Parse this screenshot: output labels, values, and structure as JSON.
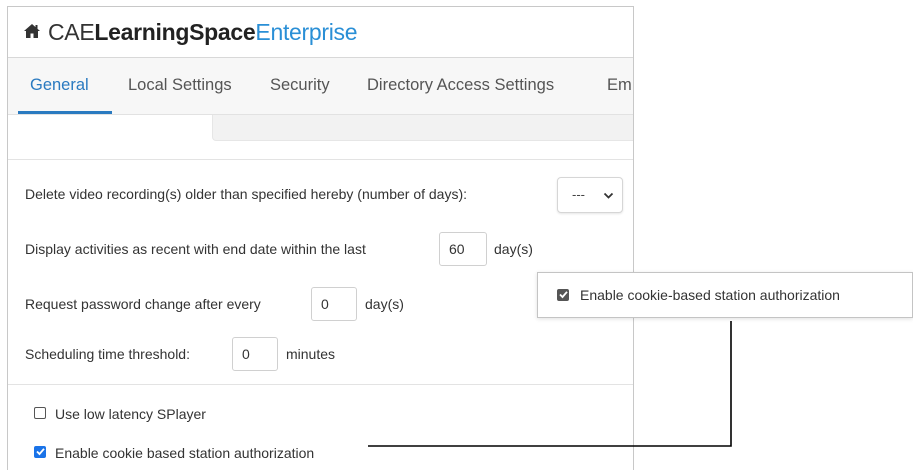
{
  "app": {
    "brand_part1": "CAE",
    "brand_part2": "LearningSpace",
    "brand_part3": "Enterprise",
    "home_icon": "home-icon"
  },
  "tabs": [
    {
      "label": "General",
      "active": true
    },
    {
      "label": "Local Settings",
      "active": false
    },
    {
      "label": "Security",
      "active": false
    },
    {
      "label": "Directory Access Settings",
      "active": false
    },
    {
      "label": "Em",
      "active": false
    }
  ],
  "settings": {
    "delete_video": {
      "label": "Delete video recording(s) older than specified hereby (number of days):",
      "value": "---"
    },
    "recent_activities": {
      "label_before": "Display activities as recent with end date within the last",
      "value": "60",
      "label_after": "day(s)"
    },
    "password_change": {
      "label_before": "Request password change after every",
      "value": "0",
      "label_after": "day(s)"
    },
    "scheduling_threshold": {
      "label_before": "Scheduling time threshold:",
      "value": "0",
      "label_after": "minutes"
    },
    "low_latency": {
      "label": "Use low latency SPlayer",
      "checked": false
    },
    "cookie_auth": {
      "label": "Enable cookie based station authorization",
      "checked": true
    }
  },
  "callout": {
    "label": "Enable cookie-based station authorization",
    "checked": true
  },
  "colors": {
    "accent": "#2a7ac0",
    "brand_blue": "#2a8fd6",
    "checkbox_blue": "#1a73e8"
  }
}
